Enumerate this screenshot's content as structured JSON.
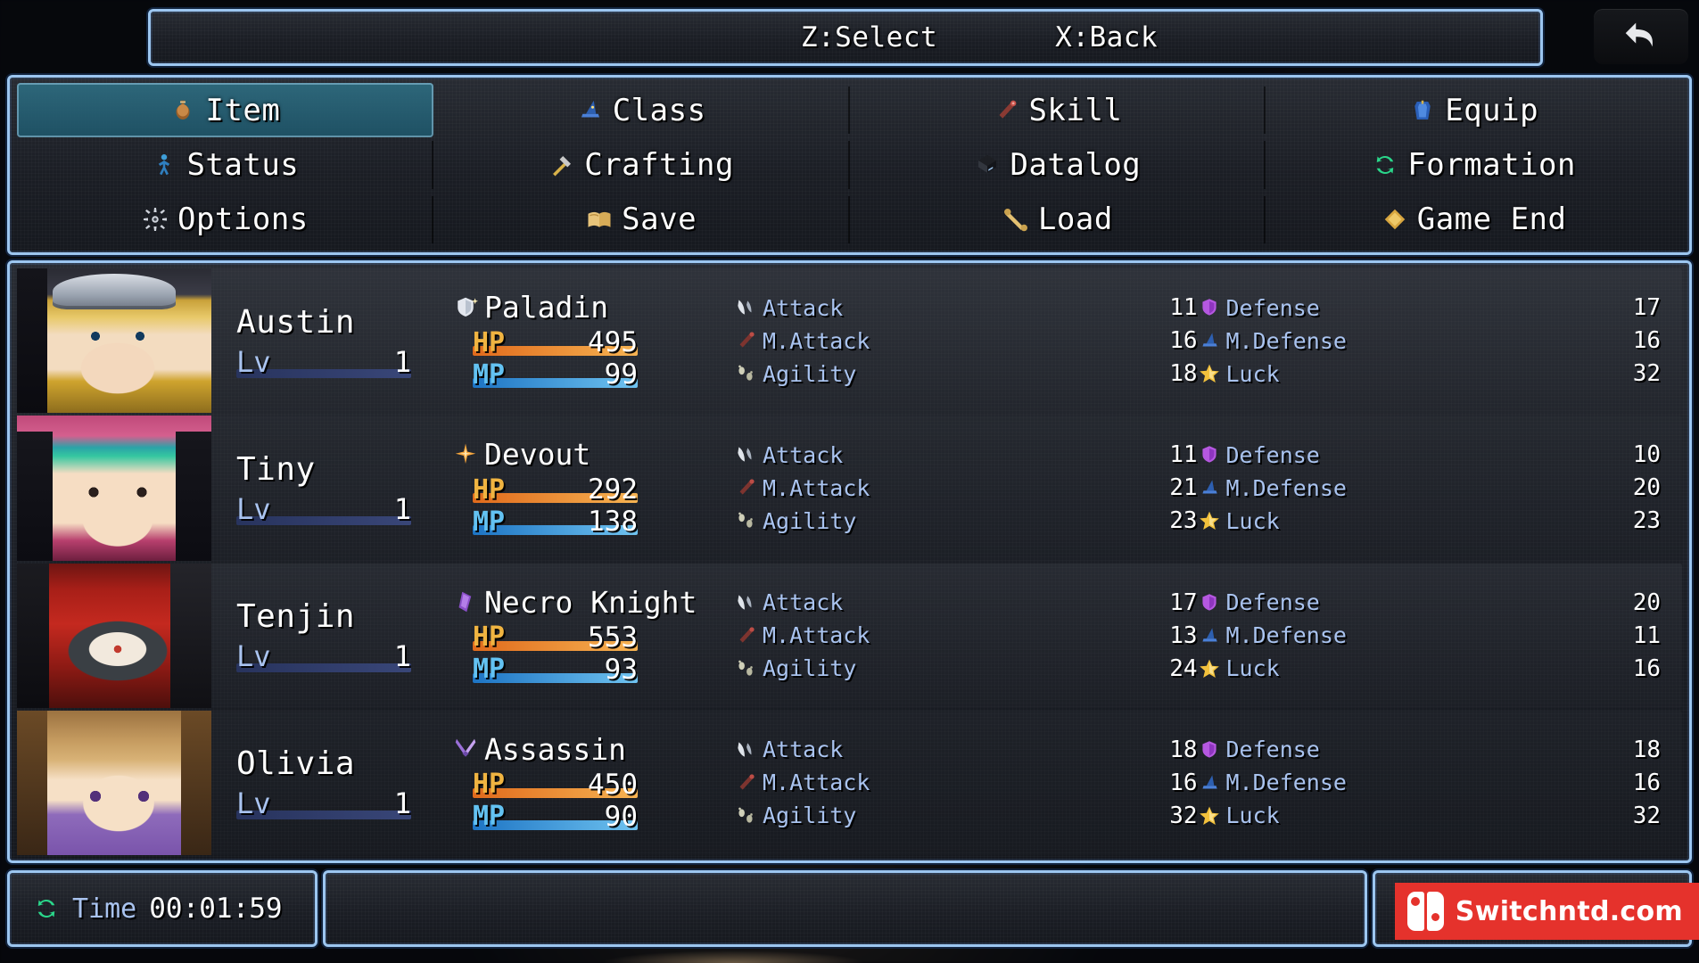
{
  "help": {
    "hints": [
      {
        "label": "Z:Select"
      },
      {
        "label": "X:Back"
      }
    ]
  },
  "back_button": {
    "name": "back-arrow",
    "label": "Back"
  },
  "command_menu": {
    "selected": "Item",
    "items": [
      {
        "label": "Item",
        "icon": "pouch-icon",
        "selected": true
      },
      {
        "label": "Class",
        "icon": "wizard-hat-icon",
        "selected": false
      },
      {
        "label": "Skill",
        "icon": "magic-wand-icon",
        "selected": false
      },
      {
        "label": "Equip",
        "icon": "armor-icon",
        "selected": false
      },
      {
        "label": "Status",
        "icon": "person-icon",
        "selected": false
      },
      {
        "label": "Crafting",
        "icon": "hammer-icon",
        "selected": false
      },
      {
        "label": "Datalog",
        "icon": "book-icon",
        "selected": false
      },
      {
        "label": "Formation",
        "icon": "refresh-icon",
        "selected": false
      },
      {
        "label": "Options",
        "icon": "sun-gear-icon",
        "selected": false
      },
      {
        "label": "Save",
        "icon": "open-book-icon",
        "selected": false
      },
      {
        "label": "Load",
        "icon": "scroll-icon",
        "selected": false
      },
      {
        "label": "Game End",
        "icon": "diamond-icon",
        "selected": false
      }
    ]
  },
  "party": {
    "labels": {
      "lv": "Lv",
      "hp": "HP",
      "mp": "MP",
      "attack": "Attack",
      "m_attack": "M.Attack",
      "agility": "Agility",
      "defense": "Defense",
      "m_defense": "M.Defense",
      "luck": "Luck"
    },
    "members": [
      {
        "name": "Austin",
        "level": "1",
        "class": "Paladin",
        "class_icon": "shield-shine-icon",
        "portrait": "austin-portrait",
        "hp": "495",
        "mp": "99",
        "attack": "11",
        "m_attack": "16",
        "agility": "18",
        "defense": "17",
        "m_defense": "16",
        "luck": "32"
      },
      {
        "name": "Tiny",
        "level": "1",
        "class": "Devout",
        "class_icon": "sparkle-star-icon",
        "portrait": "tiny-portrait",
        "hp": "292",
        "mp": "138",
        "attack": "11",
        "m_attack": "21",
        "agility": "23",
        "defense": "10",
        "m_defense": "20",
        "luck": "23"
      },
      {
        "name": "Tenjin",
        "level": "1",
        "class": "Necro Knight",
        "class_icon": "purple-gem-icon",
        "portrait": "tenjin-portrait",
        "hp": "553",
        "mp": "93",
        "attack": "17",
        "m_attack": "13",
        "agility": "24",
        "defense": "20",
        "m_defense": "11",
        "luck": "16"
      },
      {
        "name": "Olivia",
        "level": "1",
        "class": "Assassin",
        "class_icon": "crossed-daggers-icon",
        "portrait": "olivia-portrait",
        "hp": "450",
        "mp": "90",
        "attack": "18",
        "m_attack": "16",
        "agility": "32",
        "defense": "18",
        "m_defense": "16",
        "luck": "32"
      }
    ]
  },
  "footer": {
    "time_label": "Time",
    "time_value": "00:01:59"
  },
  "watermark": {
    "text": "Switchntd.com"
  },
  "colors": {
    "frame_border": "#9cc6f0",
    "selected_cell": "#2e6c80",
    "hp_bar": "#f6b352",
    "mp_bar": "#6fc3f0",
    "param_label": "#a9c3ef",
    "watermark_bg": "#e5322c"
  }
}
